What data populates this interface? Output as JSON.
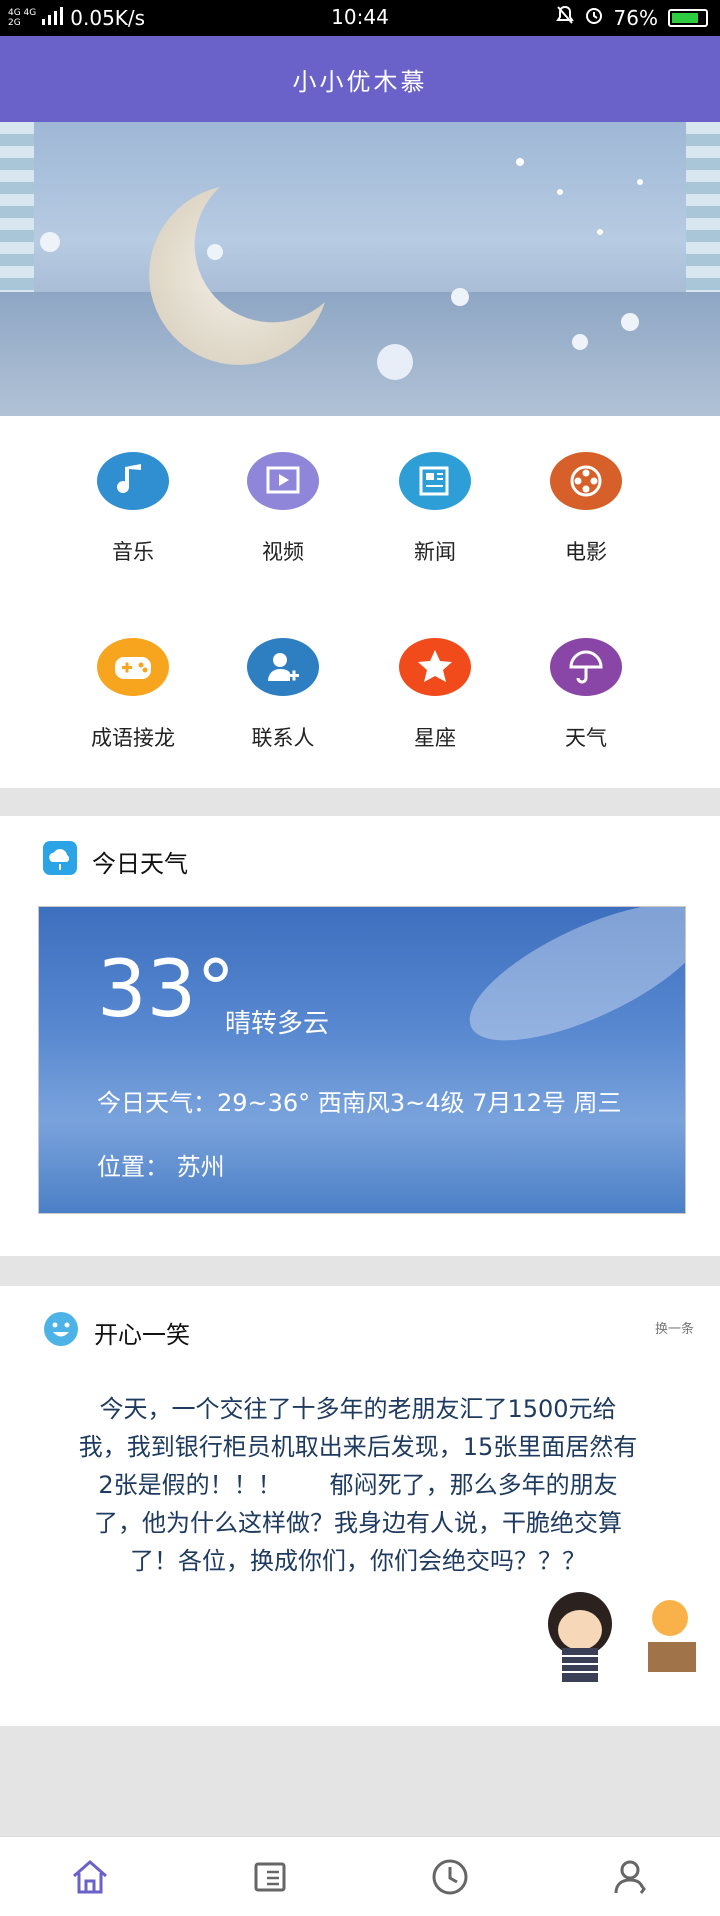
{
  "status_bar": {
    "signal_top": "4G 4G",
    "signal_bottom": "2G",
    "speed": "0.05K/s",
    "time": "10:44",
    "battery_level": "76%"
  },
  "app_bar": {
    "title": "小小优木慕"
  },
  "features": [
    {
      "label": "音乐",
      "icon": "music-note-icon",
      "color": "#2f8fd1"
    },
    {
      "label": "视频",
      "icon": "video-play-icon",
      "color": "#8f86d9"
    },
    {
      "label": "新闻",
      "icon": "newspaper-icon",
      "color": "#2d9fd6"
    },
    {
      "label": "电影",
      "icon": "film-reel-icon",
      "color": "#d7602a"
    },
    {
      "label": "成语接龙",
      "icon": "gamepad-icon",
      "color": "#f7a51f"
    },
    {
      "label": "联系人",
      "icon": "add-contact-icon",
      "color": "#2e7fc2"
    },
    {
      "label": "星座",
      "icon": "star-icon",
      "color": "#f24b1b"
    },
    {
      "label": "天气",
      "icon": "umbrella-icon",
      "color": "#8a46a6"
    }
  ],
  "weather": {
    "title": "今日天气",
    "temperature": "33°",
    "condition": "晴转多云",
    "detail": "今日天气：29~36° 西南风3~4级 7月12号 周三",
    "location": "位置： 苏州"
  },
  "joke": {
    "title": "开心一笑",
    "refresh_label": "换一条",
    "text": "今天，一个交往了十多年的老朋友汇了1500元给我，我到银行柜员机取出来后发现，15张里面居然有2张是假的！！！　　郁闷死了，那么多年的朋友了，他为什么这样做？我身边有人说，干脆绝交算了！各位，换成你们，你们会绝交吗？？？"
  },
  "bottom_nav": [
    {
      "name": "home",
      "icon": "home-icon",
      "active": true
    },
    {
      "name": "list",
      "icon": "list-icon",
      "active": false
    },
    {
      "name": "history",
      "icon": "clock-icon",
      "active": false
    },
    {
      "name": "profile",
      "icon": "user-icon",
      "active": false
    }
  ],
  "colors": {
    "app_bar": "#6a62c9",
    "nav_active": "#6a62c9",
    "nav_inactive": "#666666"
  }
}
